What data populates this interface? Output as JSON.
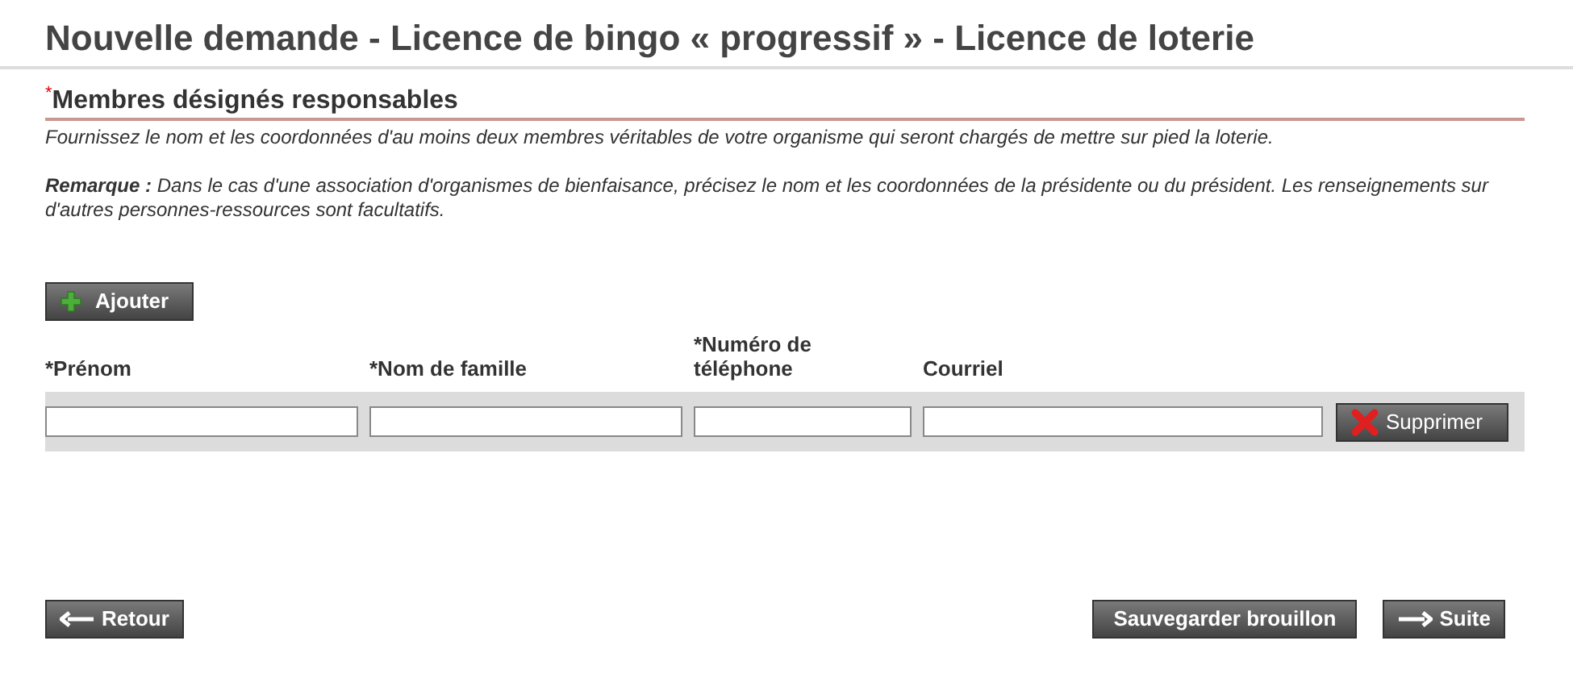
{
  "title": "Nouvelle demande - Licence de bingo « progressif » - Licence de loterie",
  "section": {
    "required_mark": "*",
    "heading": "Membres désignés responsables",
    "intro": "Fournissez le nom et les coordonnées d'au moins deux membres véritables de votre organisme qui seront chargés de mettre sur pied la loterie.",
    "note": "**Remarque :** Dans le cas d'une association d'organismes de bienfaisance, précisez le nom et les coordonnées de la présidente ou du président. Les renseignements sur d'autres personnes-ressources sont facultatifs."
  },
  "add_button": "Ajouter",
  "columns": [
    "*Prénom",
    "*Nom de famille",
    "*Numéro de téléphone",
    "Courriel"
  ],
  "rows": [
    {
      "delete_button": "Supprimer"
    }
  ],
  "footer": {
    "back_button": "Retour",
    "save_button": "Sauvegarder brouillon",
    "next_button": "Suite"
  }
}
